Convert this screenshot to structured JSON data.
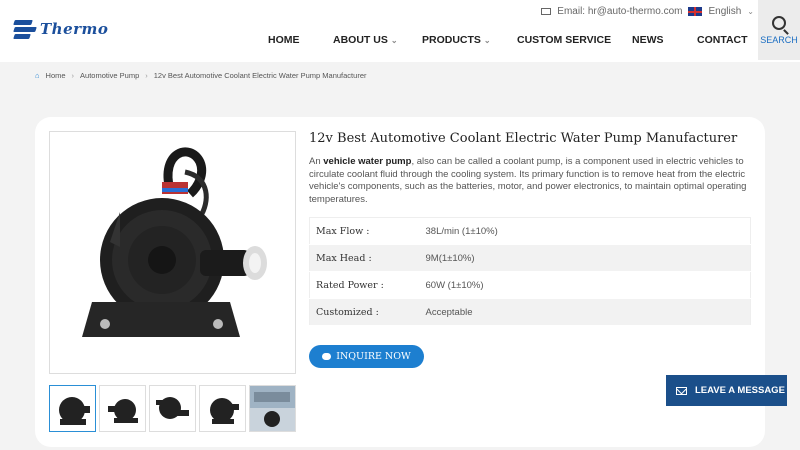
{
  "brand": {
    "name": "Thermo"
  },
  "topbar": {
    "email": "Email: hr@auto-thermo.com",
    "language": "English"
  },
  "nav": {
    "items": [
      "HOME",
      "ABOUT US",
      "PRODUCTS",
      "CUSTOM SERVICE",
      "NEWS",
      "CONTACT"
    ]
  },
  "search": {
    "label": "SEARCH"
  },
  "breadcrumb": [
    "Home",
    "Automotive Pump",
    "12v Best Automotive Coolant Electric Water Pump Manufacturer"
  ],
  "product": {
    "title": "12v Best Automotive Coolant Electric Water Pump Manufacturer",
    "desc_lead": "An ",
    "desc_bold": "vehicle water pump",
    "desc_rest": ", also can be called a coolant pump, is a component used in electric vehicles to circulate coolant fluid through the cooling system. Its primary function is to remove heat from the electric vehicle's components, such as the batteries, motor, and power electronics, to maintain optimal operating temperatures.",
    "specs": [
      {
        "key": "Max Flow :",
        "value": "38L/min (1±10%)"
      },
      {
        "key": "Max Head :",
        "value": "9M(1±10%)"
      },
      {
        "key": "Rated Power :",
        "value": "60W (1±10%)"
      },
      {
        "key": "Customized :",
        "value": "Acceptable"
      }
    ],
    "inquire_label": "INQUIRE NOW"
  },
  "leave_message": "LEAVE A MESSAGE",
  "colors": {
    "accent": "#1d7fd0",
    "brand": "#1b4f9c",
    "leave_bg": "#1b4f8a"
  }
}
